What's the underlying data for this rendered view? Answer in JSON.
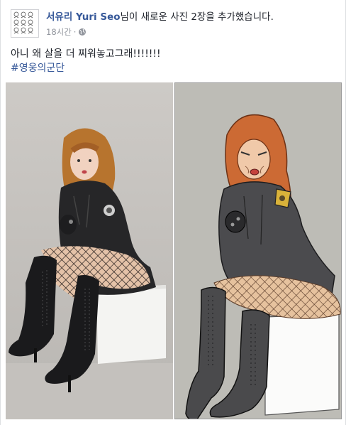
{
  "post": {
    "author": "서유리 Yuri Seo",
    "activity_text": "님이 새로운 사진 2장을 추가했습니다.",
    "timestamp": "18시간",
    "message": "아니 왜 살을 더 찌워놓고그래!!!!!!!",
    "hashtag": "#영웅의군단",
    "icons": {
      "avatar": "profile-avatar",
      "privacy": "globe-icon"
    },
    "photos": [
      {
        "name": "photo-real",
        "description_icon": "photograph"
      },
      {
        "name": "photo-drawing",
        "description_icon": "illustration"
      }
    ]
  },
  "colors": {
    "link": "#365899",
    "meta": "#90949c",
    "text": "#1d2129",
    "photo_bg": "#c9c6c2",
    "drawing_bg": "#bbbab4",
    "hair": "#c8612c",
    "jacket": "#2a2a2c",
    "drawing_jacket": "#4a4a4c"
  }
}
